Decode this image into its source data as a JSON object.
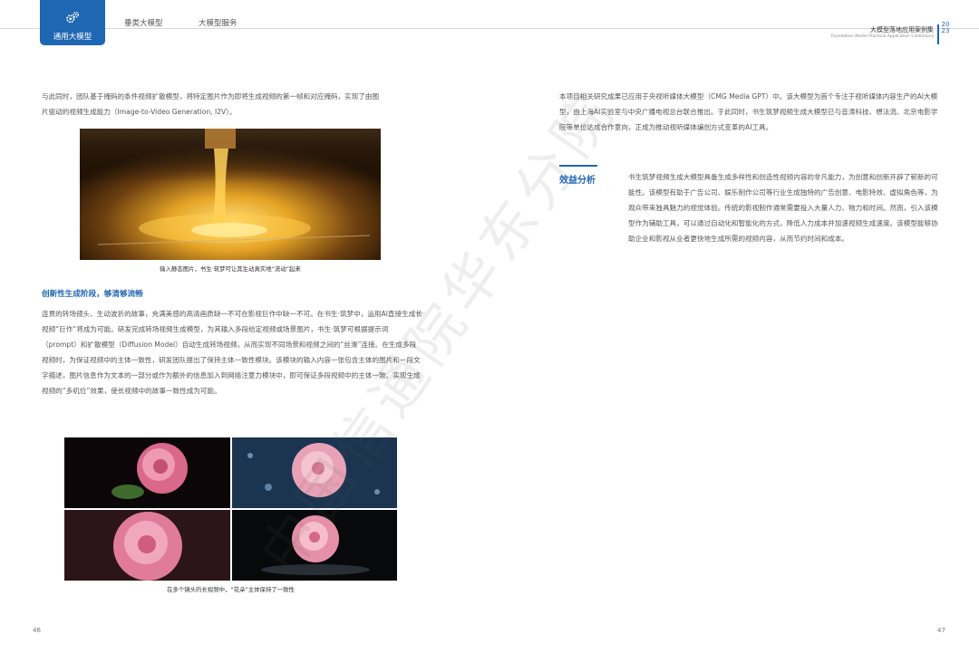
{
  "header": {
    "active_tab": "通用大模型",
    "tabs": [
      "垂类大模型",
      "大模型服务"
    ],
    "report_title": "大模型落地应用案例集",
    "report_subtitle": "Foundation Model Practical Application Collections",
    "year": "2023"
  },
  "left": {
    "intro": "与此同时，团队基于掩码的条件视频扩散模型，将特定图片作为即将生成视频的第一帧和对应掩码，实现了由图片驱动的视频生成能力（Image-to-Video Generation, I2V）。",
    "caption1": "输入静态图片，书生·筑梦可让其生动真实地“流动”起来",
    "section_title": "创新性生成阶段，够清够流畅",
    "body": "连贯的转场镜头、生动波折的故事，充满美感的高清画质缺一不可在影视巨作中缺一不可。在书生·筑梦中，运用AI直接生成长视频“巨作”将成为可能。研发完成转场视频生成模型，为其输入多段给定视频或场景图片，书生·筑梦可根据提示词（prompt）和扩散模型（Diffusion Model）自动生成转场视频，从而实现不同场景和视频之间的“丝滑”连接。在生成多段视频时，为保证视频中的主体一致性，研发团队提出了保持主体一致性模块。该模块的输入内容一张包含主体的图片和一段文字描述，图片信息作为文本的一部分或作为额外的信息加入到网络注意力模块中，即可保证多段视频中的主体一致。实现生成视频的“多机位”效果，使长视频中的故事一致性成为可能。",
    "caption2": "在多个镜头的长视频中，“花朵”主体保持了一致性"
  },
  "right": {
    "intro": "本项目相关研究成果已应用于央视听媒体大模型（CMG Media GPT）中。该大模型为首个专注于视听媒体内容生产的AI大模型，由上海AI实验室与中央广播电视总台联合推出。于此同时，书生筑梦视频生成大模型已与音涛科技、想法流、北京电影学院等单位达成合作意向，正成为推动视听媒体编创方式变革的AI工具。",
    "benefit_title": "效益分析",
    "benefit_body": "书生筑梦视频生成大模型具备生成多样性和创造性视频内容的非凡能力，为创意和创新开辟了崭新的可能性。该模型有助于广告公司、娱乐制作公司等行业生成独特的广告创意、电影特效、虚拟角色等，为观众带来独具魅力的视觉体验。传统的影视制作通常需要投入大量人力、物力和时间。然而，引入该模型作为辅助工具，可以通过自动化和智能化的方式，降低人力成本并加速视频生成速度。该模型能够协助企业和影视从业者更快地生成所需的视频内容，从而节约时间和成本。"
  },
  "page_numbers": {
    "left": "46",
    "right": "47"
  },
  "watermark": "中国信通院华东分院"
}
